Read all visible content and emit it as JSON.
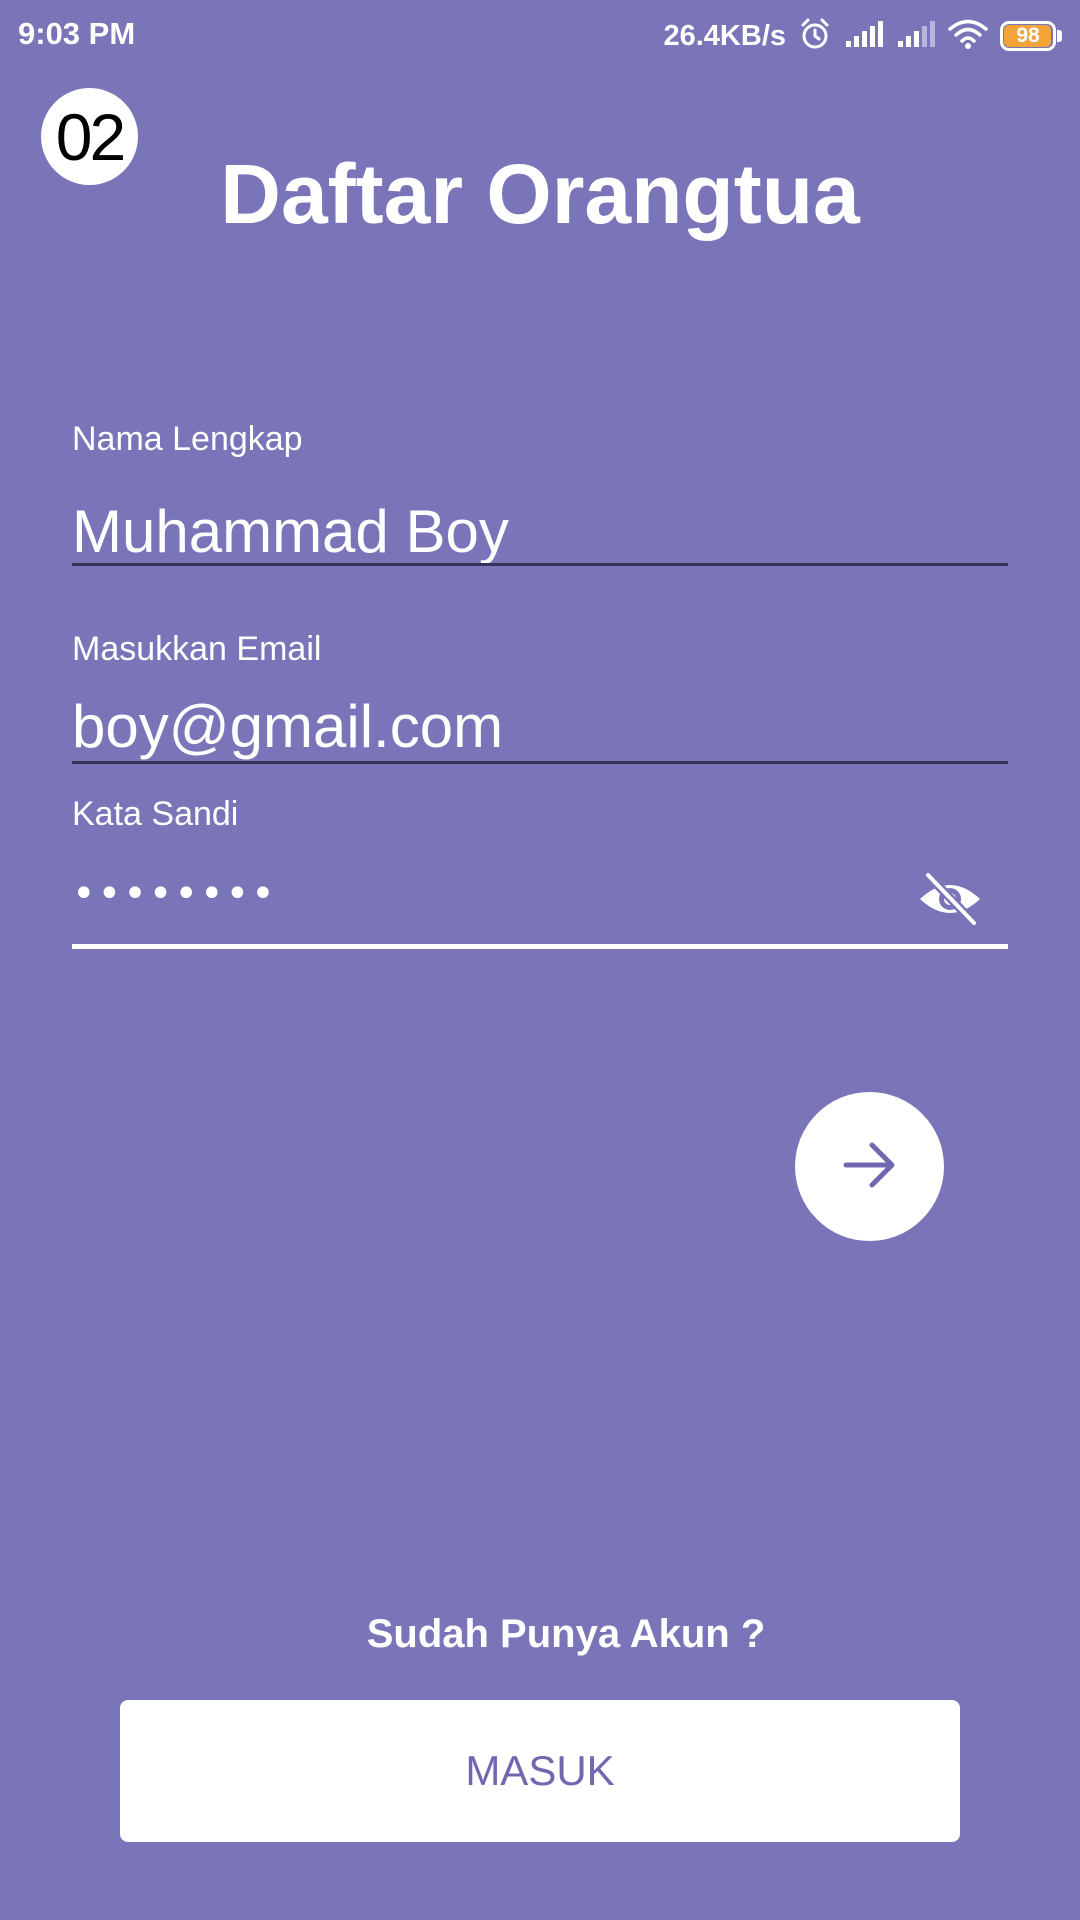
{
  "status_bar": {
    "time": "9:03 PM",
    "net_speed": "26.4KB/s",
    "battery_level": "98",
    "battery_fraction": 0.98,
    "icons": [
      "alarm-icon",
      "signal-icon",
      "signal-icon",
      "wifi-icon",
      "battery-icon"
    ]
  },
  "step_badge": "02",
  "title": "Daftar Orangtua",
  "form": {
    "name_label": "Nama Lengkap",
    "name_value": "Muhammad Boy",
    "email_label": "Masukkan Email",
    "email_value": "boy@gmail.com",
    "password_label": "Kata Sandi",
    "password_mask": "••••••••",
    "visibility_icon": "visibility-off-icon"
  },
  "next_icon": "arrow-right-icon",
  "login_prompt": "Sudah Punya Akun ?",
  "login_button_label": "MASUK",
  "colors": {
    "background": "#7a74b8",
    "accent": "#6f68b0",
    "battery": "#f2a33a",
    "underline": "#35315a"
  }
}
